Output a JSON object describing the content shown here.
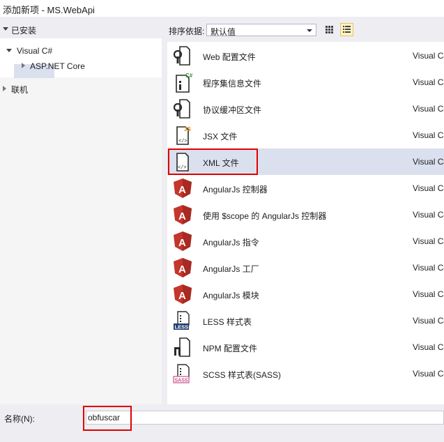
{
  "window": {
    "title": "添加新项 - MS.WebApi"
  },
  "left_panel": {
    "installed_label": "已安装",
    "tree": [
      {
        "label": "Visual C#",
        "expanded": true,
        "selected": true
      },
      {
        "label": "ASP.NET Core",
        "expanded": false,
        "selected": false
      }
    ],
    "online_label": "联机"
  },
  "sort": {
    "label": "排序依据:",
    "selected": "默认值",
    "views": [
      {
        "name": "grid-view-icon",
        "active": false
      },
      {
        "name": "list-view-icon",
        "active": true
      }
    ]
  },
  "templates": [
    {
      "name": "Web 配置文件",
      "type": "Visual C#",
      "icon": "web-config-file-icon"
    },
    {
      "name": "程序集信息文件",
      "type": "Visual C#",
      "icon": "assembly-info-file-icon"
    },
    {
      "name": "协议缓冲区文件",
      "type": "Visual C#",
      "icon": "protocol-buffer-file-icon"
    },
    {
      "name": "JSX 文件",
      "type": "Visual C#",
      "icon": "jsx-file-icon"
    },
    {
      "name": "XML 文件",
      "type": "Visual C#",
      "icon": "xml-file-icon",
      "selected": true
    },
    {
      "name": "AngularJs 控制器",
      "type": "Visual C#",
      "icon": "angularjs-icon"
    },
    {
      "name": "使用 $scope 的 AngularJs 控制器",
      "type": "Visual C#",
      "icon": "angularjs-icon"
    },
    {
      "name": "AngularJs 指令",
      "type": "Visual C#",
      "icon": "angularjs-icon"
    },
    {
      "name": "AngularJs 工厂",
      "type": "Visual C#",
      "icon": "angularjs-icon"
    },
    {
      "name": "AngularJs 模块",
      "type": "Visual C#",
      "icon": "angularjs-icon"
    },
    {
      "name": "LESS 样式表",
      "type": "Visual C#",
      "icon": "less-stylesheet-icon"
    },
    {
      "name": "NPM 配置文件",
      "type": "Visual C#",
      "icon": "npm-config-file-icon"
    },
    {
      "name": "SCSS 样式表(SASS)",
      "type": "Visual C#",
      "icon": "scss-stylesheet-icon"
    }
  ],
  "name_field": {
    "label": "名称(N):",
    "value": "obfuscar"
  },
  "colors": {
    "selection": "#dbe0ef",
    "highlight": "#e00000",
    "angular": "#c4352b",
    "less": "#1f3e6e",
    "scss": "#c6538c"
  }
}
